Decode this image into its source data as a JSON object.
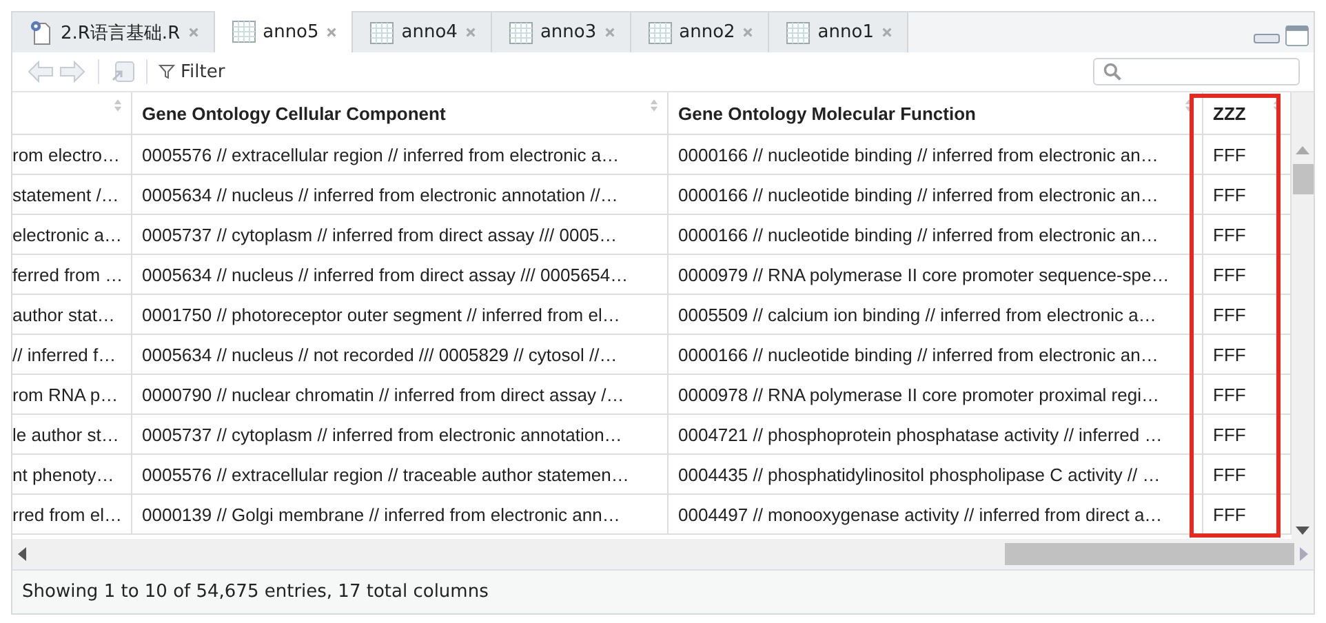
{
  "tabs": [
    {
      "label": "2.R语言基础.R",
      "kind": "script",
      "selected": false
    },
    {
      "label": "anno5",
      "kind": "table",
      "selected": true
    },
    {
      "label": "anno4",
      "kind": "table",
      "selected": false
    },
    {
      "label": "anno3",
      "kind": "table",
      "selected": false
    },
    {
      "label": "anno2",
      "kind": "table",
      "selected": false
    },
    {
      "label": "anno1",
      "kind": "table",
      "selected": false
    }
  ],
  "toolbar": {
    "filter": "Filter"
  },
  "table": {
    "columns": [
      "",
      "Gene Ontology Cellular Component",
      "Gene Ontology Molecular Function",
      "ZZZ"
    ],
    "rows": [
      [
        "rom electro…",
        "0005576 // extracellular region // inferred from electronic a…",
        "0000166 // nucleotide binding // inferred from electronic an…",
        "FFF"
      ],
      [
        "statement /…",
        "0005634 // nucleus // inferred from electronic annotation //…",
        "0000166 // nucleotide binding // inferred from electronic an…",
        "FFF"
      ],
      [
        "electronic a…",
        "0005737 // cytoplasm // inferred from direct assay /// 0005…",
        "0000166 // nucleotide binding // inferred from electronic an…",
        "FFF"
      ],
      [
        "ferred from …",
        "0005634 // nucleus // inferred from direct assay /// 0005654…",
        "0000979 // RNA polymerase II core promoter sequence-spe…",
        "FFF"
      ],
      [
        "author stat…",
        "0001750 // photoreceptor outer segment // inferred from el…",
        "0005509 // calcium ion binding // inferred from electronic a…",
        "FFF"
      ],
      [
        "// inferred f…",
        "0005634 // nucleus // not recorded /// 0005829 // cytosol //…",
        "0000166 // nucleotide binding // inferred from electronic an…",
        "FFF"
      ],
      [
        "rom RNA p…",
        "0000790 // nuclear chromatin // inferred from direct assay /…",
        "0000978 // RNA polymerase II core promoter proximal regi…",
        "FFF"
      ],
      [
        "le author st…",
        "0005737 // cytoplasm // inferred from electronic annotation…",
        "0004721 // phosphoprotein phosphatase activity // inferred …",
        "FFF"
      ],
      [
        "nt phenoty…",
        "0005576 // extracellular region // traceable author statemen…",
        "0004435 // phosphatidylinositol phospholipase C activity // …",
        "FFF"
      ],
      [
        "rred from el…",
        "0000139 // Golgi membrane // inferred from electronic ann…",
        "0004497 // monooxygenase activity // inferred from direct a…",
        "FFF"
      ]
    ]
  },
  "status_bar": "Showing 1 to 10 of 54,675 entries, 17 total columns"
}
